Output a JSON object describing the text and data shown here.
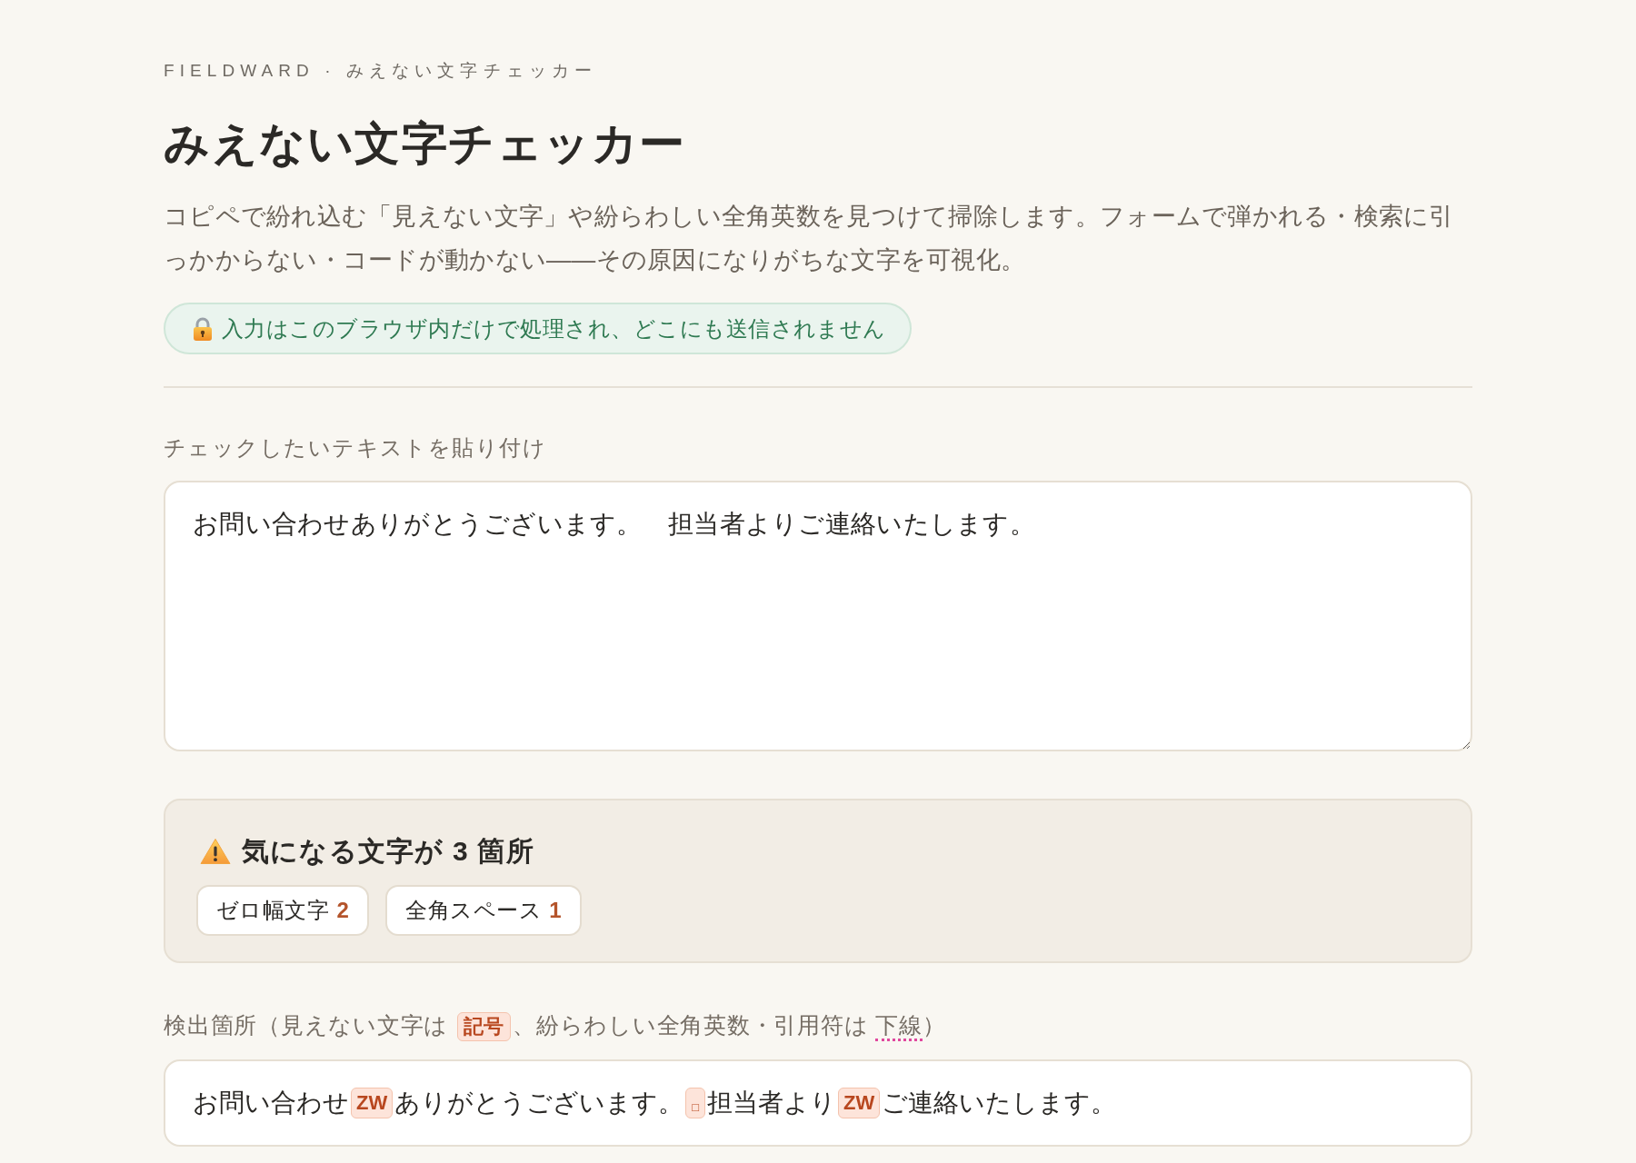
{
  "header": {
    "eyebrow": "FIELDWARD · みえない文字チェッカー",
    "title": "みえない文字チェッカー",
    "description": "コピペで紛れ込む「見えない文字」や紛らわしい全角英数を見つけて掃除します。フォームで弾かれる・検索に引っかからない・コードが動かない——その原因になりがちな文字を可視化。",
    "privacy_note": "入力はこのブラウザ内だけで処理され、どこにも送信されません"
  },
  "input": {
    "label": "チェックしたいテキストを貼り付け",
    "value": "お問い合わせありがとうございます。　担当者よりご連絡いたします。"
  },
  "summary": {
    "heading": "気になる文字が 3 箇所",
    "counts": [
      {
        "label": "ゼロ幅文字",
        "count": "2"
      },
      {
        "label": "全角スペース",
        "count": "1"
      }
    ]
  },
  "results": {
    "legend": [
      {
        "kind": "text",
        "text": "検出箇所（見えない文字は "
      },
      {
        "kind": "mark_sample",
        "text": "記号"
      },
      {
        "kind": "text",
        "text": "、紛らわしい全角英数・引用符は "
      },
      {
        "kind": "underline_sample",
        "text": "下線"
      },
      {
        "kind": "text",
        "text": "）"
      }
    ],
    "segments": [
      {
        "kind": "text",
        "text": "お問い合わせ"
      },
      {
        "kind": "zero_width",
        "text": "ZW"
      },
      {
        "kind": "text",
        "text": "ありがとうございます。"
      },
      {
        "kind": "fullwidth_space",
        "text": "□"
      },
      {
        "kind": "text",
        "text": "担当者より"
      },
      {
        "kind": "zero_width",
        "text": "ZW"
      },
      {
        "kind": "text",
        "text": "ご連絡いたします。"
      }
    ]
  }
}
